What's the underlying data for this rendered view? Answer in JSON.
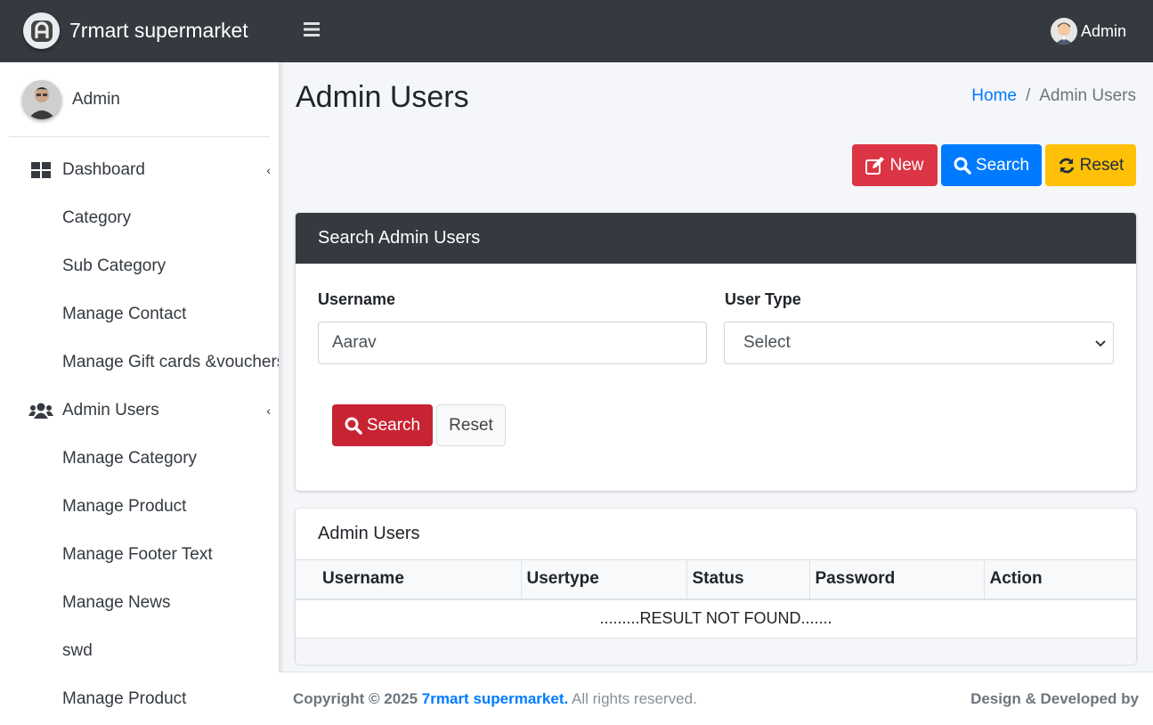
{
  "brand": {
    "name": "7rmart supermarket",
    "logo_icon": "brand-logo-icon"
  },
  "topbar": {
    "menu_icon": "hamburger-icon",
    "user_label": "Admin"
  },
  "sidebar": {
    "user_name": "Admin",
    "items": [
      {
        "label": "Dashboard",
        "icon": "dashboard-icon",
        "caret": "‹"
      },
      {
        "label": "Category"
      },
      {
        "label": "Sub Category"
      },
      {
        "label": "Manage Contact"
      },
      {
        "label": "Manage Gift cards &vouchers"
      },
      {
        "label": "Admin Users",
        "icon": "users-icon",
        "caret": "‹"
      },
      {
        "label": "Manage Category"
      },
      {
        "label": "Manage Product"
      },
      {
        "label": "Manage Footer Text"
      },
      {
        "label": "Manage News"
      },
      {
        "label": "swd"
      },
      {
        "label": "Manage Product"
      }
    ]
  },
  "header": {
    "title": "Admin Users",
    "breadcrumb": {
      "home": "Home",
      "separator": "/",
      "current": "Admin Users"
    }
  },
  "actions": {
    "new": "New",
    "search": "Search",
    "reset": "Reset"
  },
  "search_card": {
    "title": "Search Admin Users",
    "username_label": "Username",
    "username_value": "Aarav",
    "usertype_label": "User Type",
    "usertype_value": "Select",
    "search_button": "Search",
    "reset_button": "Reset"
  },
  "table_card": {
    "title": "Admin Users",
    "columns": [
      "Username",
      "Usertype",
      "Status",
      "Password",
      "Action"
    ],
    "empty_message": ".........RESULT NOT FOUND......."
  },
  "footer": {
    "copyright_prefix": "Copyright © 2025",
    "brand_link": "7rmart supermarket.",
    "rights": "All rights reserved.",
    "credit": "Design & Developed by"
  },
  "colors": {
    "dark": "#343a40",
    "danger": "#dc3545",
    "primary": "#007bff",
    "warning": "#ffc107"
  }
}
